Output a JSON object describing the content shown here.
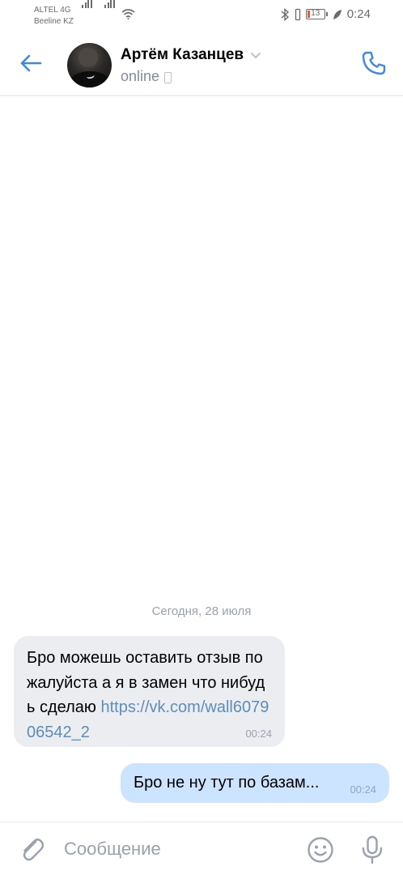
{
  "status_bar": {
    "carrier1": "ALTEL 4G",
    "carrier2": "Beeline KZ",
    "battery": "13",
    "time": "0:24"
  },
  "header": {
    "name": "Артём Казанцев",
    "status": "online",
    "back_icon": "arrow-left-icon",
    "call_icon": "phone-icon"
  },
  "chat": {
    "date_separator": "Сегодня, 28 июля",
    "messages": [
      {
        "direction": "incoming",
        "text": "Бро можешь оставить отзыв пожалуйста а я в замен что нибудь сделаю ",
        "link": "https://vk.com/wall607906542_2",
        "time": "00:24"
      },
      {
        "direction": "outgoing",
        "text": "Бро не ну тут по базам...",
        "time": "00:24"
      }
    ]
  },
  "composer": {
    "placeholder": "Сообщение",
    "value": ""
  },
  "colors": {
    "accent": "#3f8ae0",
    "incoming_bubble": "#ebedf0",
    "outgoing_bubble": "#cce4ff",
    "link": "#5d8db9",
    "muted": "#99a2ad"
  }
}
